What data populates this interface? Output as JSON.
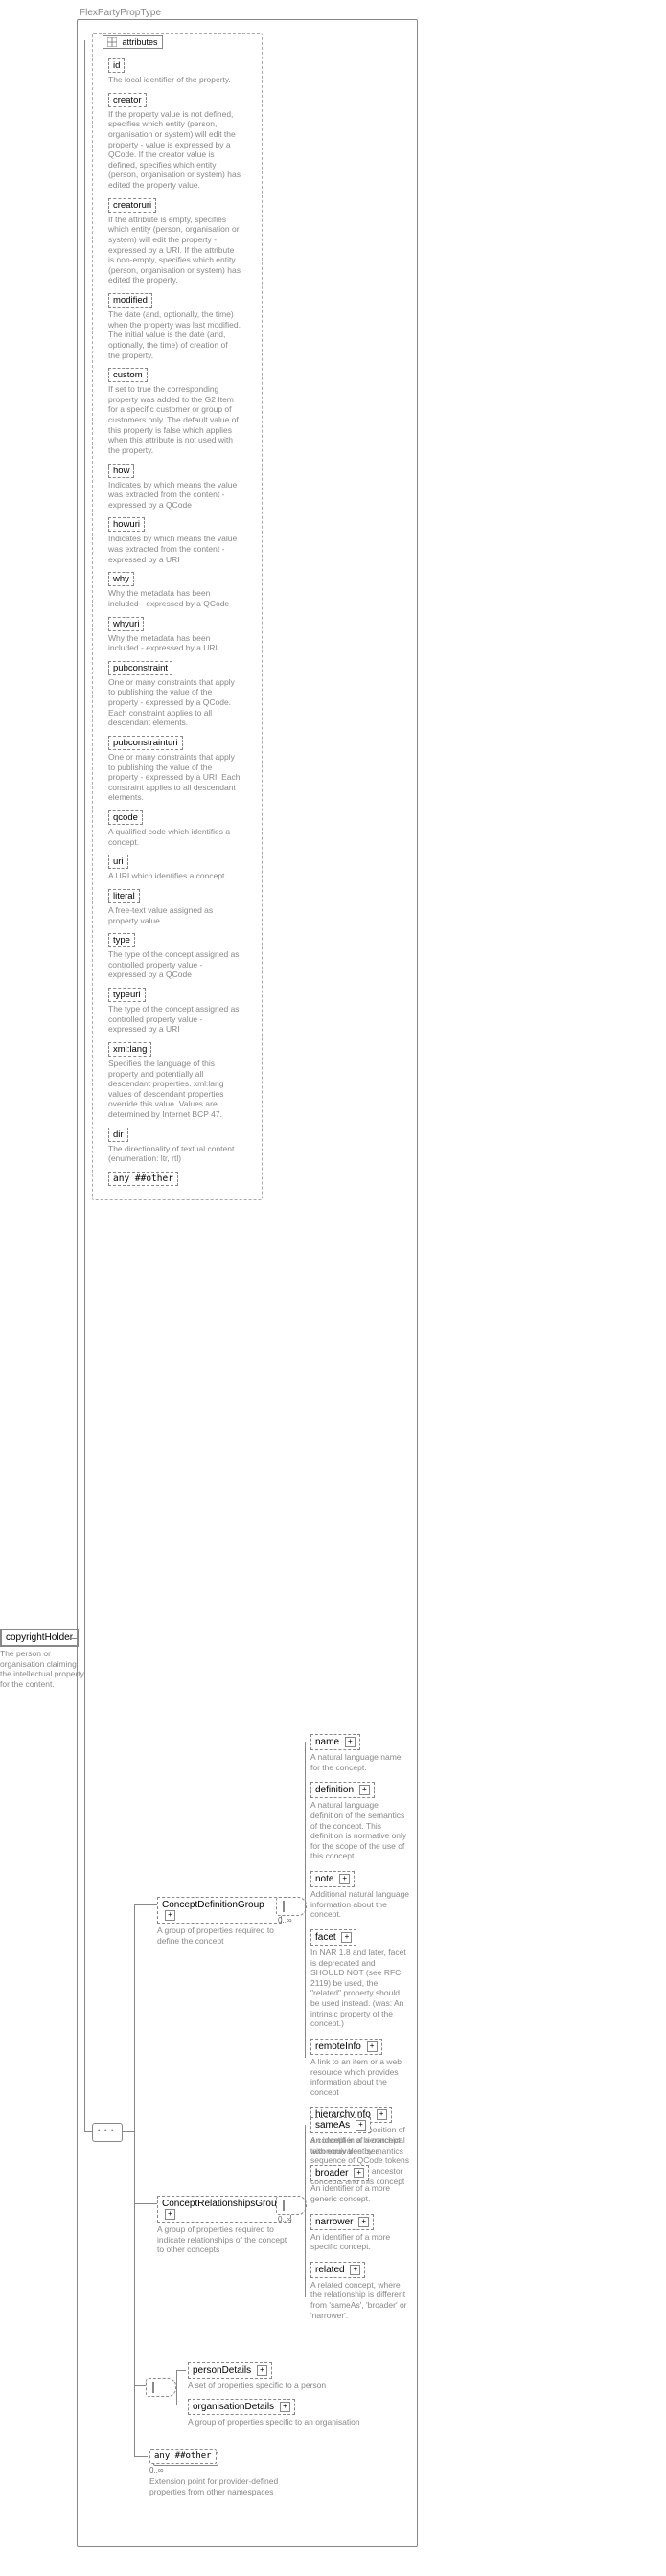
{
  "type_name": "FlexPartyPropType",
  "root": {
    "name": "copyrightHolder",
    "desc": "The person or organisation claiming the intellectual property for the content."
  },
  "attributes_label": "attributes",
  "attributes": [
    {
      "name": "id",
      "desc": "The local identifier of the property."
    },
    {
      "name": "creator",
      "desc": "If the property value is not defined, specifies which entity (person, organisation or system) will edit the property - value is expressed by a QCode. If the creator value is defined, specifies which entity (person, organisation or system) has edited the property value."
    },
    {
      "name": "creatoruri",
      "desc": "If the attribute is empty, specifies which entity (person, organisation or system) will edit the property - expressed by a URI. If the attribute is non-empty, specifies which entity (person, organisation or system) has edited the property."
    },
    {
      "name": "modified",
      "desc": "The date (and, optionally, the time) when the property was last modified. The initial value is the date (and, optionally, the time) of creation of the property."
    },
    {
      "name": "custom",
      "desc": "If set to true the corresponding property was added to the G2 Item for a specific customer or group of customers only. The default value of this property is false which applies when this attribute is not used with the property."
    },
    {
      "name": "how",
      "desc": "Indicates by which means the value was extracted from the content - expressed by a QCode"
    },
    {
      "name": "howuri",
      "desc": "Indicates by which means the value was extracted from the content - expressed by a URI"
    },
    {
      "name": "why",
      "desc": "Why the metadata has been included - expressed by a QCode"
    },
    {
      "name": "whyuri",
      "desc": "Why the metadata has been included - expressed by a URI"
    },
    {
      "name": "pubconstraint",
      "desc": "One or many constraints that apply to publishing the value of the property - expressed by a QCode. Each constraint applies to all descendant elements."
    },
    {
      "name": "pubconstrainturi",
      "desc": "One or many constraints that apply to publishing the value of the property - expressed by a URI. Each constraint applies to all descendant elements."
    },
    {
      "name": "qcode",
      "desc": "A qualified code which identifies a concept."
    },
    {
      "name": "uri",
      "desc": "A URI which identifies a concept."
    },
    {
      "name": "literal",
      "desc": "A free-text value assigned as property value."
    },
    {
      "name": "type",
      "desc": "The type of the concept assigned as controlled property value - expressed by a QCode"
    },
    {
      "name": "typeuri",
      "desc": "The type of the concept assigned as controlled property value - expressed by a URI"
    },
    {
      "name": "xml:lang",
      "desc": "Specifies the language of this property and potentially all descendant properties. xml:lang values of descendant properties override this value. Values are determined by Internet BCP 47."
    },
    {
      "name": "dir",
      "desc": "The directionality of textual content (enumeration: ltr, rtl)"
    }
  ],
  "any_other": "any ##other",
  "groups": {
    "concept_def": {
      "name": "ConceptDefinitionGroup",
      "desc": "A group of properties required to define the concept",
      "occurs": "0..∞"
    },
    "concept_rel": {
      "name": "ConceptRelationshipsGroup",
      "desc": "A group of properties required to indicate relationships of the concept to other concepts",
      "occurs": "0..∞"
    }
  },
  "def_children": [
    {
      "name": "name",
      "desc": "A natural language name for the concept."
    },
    {
      "name": "definition",
      "desc": "A natural language definition of the semantics of the concept. This definition is normative only for the scope of the use of this concept."
    },
    {
      "name": "note",
      "desc": "Additional natural language information about the concept."
    },
    {
      "name": "facet",
      "desc": "In NAR 1.8 and later, facet is deprecated and SHOULD NOT (see RFC 2119) be used, the \"related\" property should be used instead. (was: An intrinsic property of the concept.)"
    },
    {
      "name": "remoteInfo",
      "desc": "A link to an item or a web resource which provides information about the concept"
    },
    {
      "name": "hierarchyInfo",
      "desc": "Represents the position of a concept in a hierarchical taxonomy tree by a sequence of QCode tokens representing the ancestor concepts and this concept"
    }
  ],
  "rel_children": [
    {
      "name": "sameAs",
      "desc": "An identifier of a concept with equivalent semantics"
    },
    {
      "name": "broader",
      "desc": "An identifier of a more generic concept."
    },
    {
      "name": "narrower",
      "desc": "An identifier of a more specific concept."
    },
    {
      "name": "related",
      "desc": "A related concept, where the relationship is different from 'sameAs', 'broader' or 'narrower'."
    }
  ],
  "details": {
    "person": {
      "name": "personDetails",
      "desc": "A set of properties specific to a person"
    },
    "org": {
      "name": "organisationDetails",
      "desc": "A group of properties specific to an organisation"
    }
  },
  "bottom_any": {
    "label": "any ##other",
    "occurs": "0..∞",
    "desc": "Extension point for provider-defined properties from other namespaces"
  }
}
